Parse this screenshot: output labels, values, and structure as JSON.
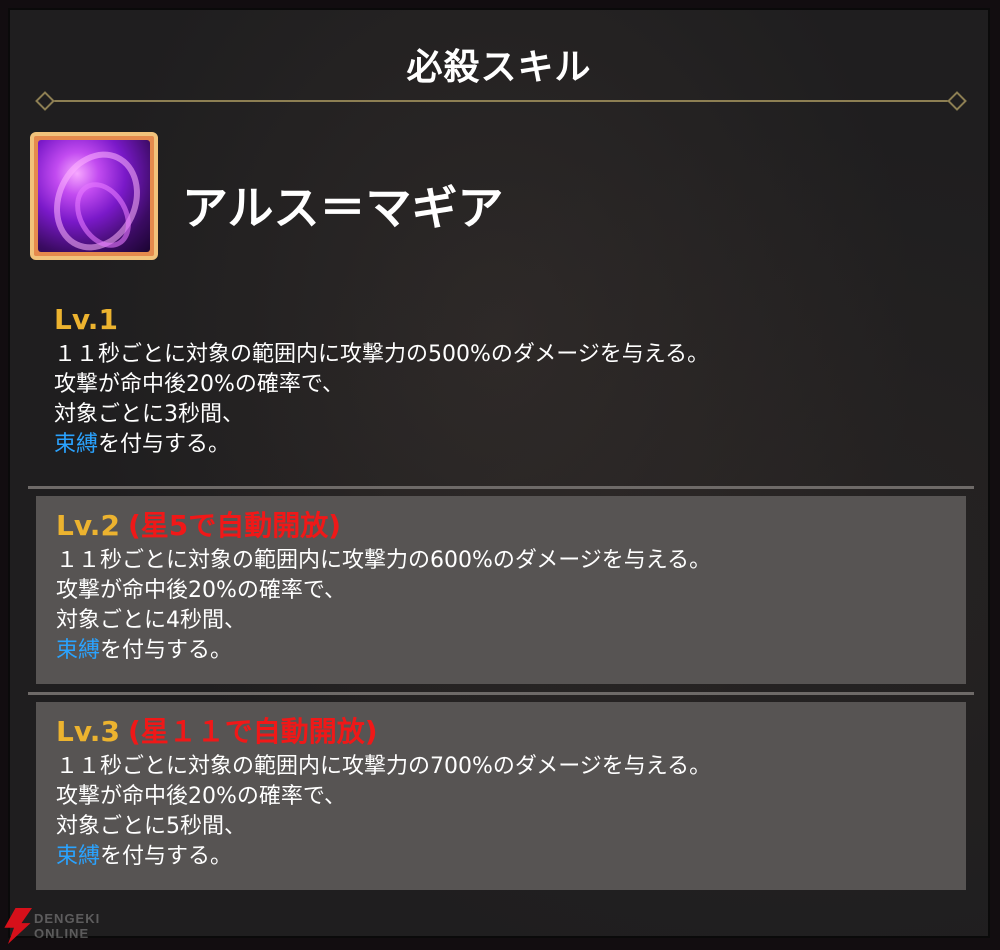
{
  "panel": {
    "title": "必殺スキル"
  },
  "skill": {
    "icon": "dark-purple-swirl-skill-icon",
    "name": "アルス＝マギア"
  },
  "levels": [
    {
      "level": "Lv.1",
      "unlock": "",
      "line1": "１１秒ごとに対象の範囲内に攻撃力の500%のダメージを与える。",
      "line2": "攻撃が命中後20%の確率で、",
      "line3": "対象ごとに3秒間、",
      "keyword": "束縛",
      "line4_rest": "を付与する。"
    },
    {
      "level": "Lv.2",
      "unlock": "(星5で自動開放)",
      "line1": "１１秒ごとに対象の範囲内に攻撃力の600%のダメージを与える。",
      "line2": "攻撃が命中後20%の確率で、",
      "line3": "対象ごとに4秒間、",
      "keyword": "束縛",
      "line4_rest": "を付与する。"
    },
    {
      "level": "Lv.3",
      "unlock": "(星１１で自動開放)",
      "line1": "１１秒ごとに対象の範囲内に攻撃力の700%のダメージを与える。",
      "line2": "攻撃が命中後20%の確率で、",
      "line3": "対象ごとに5秒間、",
      "keyword": "束縛",
      "line4_rest": "を付与する。"
    }
  ],
  "watermark": {
    "line1": "DENGEKI",
    "line2": "ONLINE"
  },
  "colors": {
    "level_label": "#ecb32f",
    "unlock_label": "#f01818",
    "keyword": "#2aa3ff",
    "divider": "#8d7f53"
  }
}
